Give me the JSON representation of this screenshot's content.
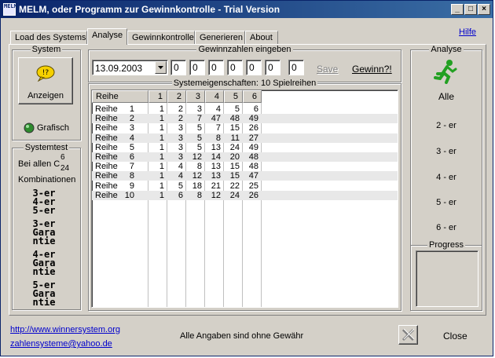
{
  "window": {
    "title": "MELM, oder Programm zur Gewinnkontrolle - Trial Version",
    "icon_text": "MELM",
    "controls": [
      "_",
      "□",
      "×"
    ]
  },
  "tabs": [
    {
      "label": "Load des Systems",
      "active": false
    },
    {
      "label": "Analyse",
      "active": true
    },
    {
      "label": "Gewinnkontrolle",
      "active": false
    },
    {
      "label": "Generieren",
      "active": false
    },
    {
      "label": "About",
      "active": false
    }
  ],
  "help_link": "Hilfe",
  "system": {
    "title": "System",
    "show_button": "Anzeigen",
    "grafisch_label": "Grafisch"
  },
  "systemtest": {
    "title": "Systemtest",
    "bei_allen": "Bei allen C",
    "sup": "6",
    "sub": "24",
    "kombinationen": "Kombinationen",
    "lines": [
      "3-er",
      "4-er",
      "5-er",
      "3-er",
      "Gara",
      "ntie",
      "4-er",
      "Gara",
      "ntie",
      "5-er",
      "Gara",
      "ntie"
    ]
  },
  "gewinnzahlen": {
    "title": "Gewinnzahlen eingeben",
    "date": "13.09.2003",
    "numbers": [
      "0",
      "0",
      "0",
      "0",
      "0",
      "0",
      "0"
    ],
    "save_label": "Save",
    "gewinn_label": "Gewinn?!"
  },
  "systemeigenschaften": {
    "title": "Systemeigenschaften: 10 Spielreihen",
    "columns": [
      "Reihe",
      "1",
      "2",
      "3",
      "4",
      "5",
      "6"
    ],
    "rows": [
      {
        "label": "Reihe",
        "num": "1",
        "values": [
          "1",
          "2",
          "3",
          "4",
          "5",
          "6"
        ]
      },
      {
        "label": "Reihe",
        "num": "2",
        "values": [
          "1",
          "2",
          "7",
          "47",
          "48",
          "49"
        ]
      },
      {
        "label": "Reihe",
        "num": "3",
        "values": [
          "1",
          "3",
          "5",
          "7",
          "15",
          "26"
        ]
      },
      {
        "label": "Reihe",
        "num": "4",
        "values": [
          "1",
          "3",
          "5",
          "8",
          "11",
          "27"
        ]
      },
      {
        "label": "Reihe",
        "num": "5",
        "values": [
          "1",
          "3",
          "5",
          "13",
          "24",
          "49"
        ]
      },
      {
        "label": "Reihe",
        "num": "6",
        "values": [
          "1",
          "3",
          "12",
          "14",
          "20",
          "48"
        ]
      },
      {
        "label": "Reihe",
        "num": "7",
        "values": [
          "1",
          "4",
          "8",
          "13",
          "15",
          "48"
        ]
      },
      {
        "label": "Reihe",
        "num": "8",
        "values": [
          "1",
          "4",
          "12",
          "13",
          "15",
          "47"
        ]
      },
      {
        "label": "Reihe",
        "num": "9",
        "values": [
          "1",
          "5",
          "18",
          "21",
          "22",
          "25"
        ]
      },
      {
        "label": "Reihe",
        "num": "10",
        "values": [
          "1",
          "6",
          "8",
          "12",
          "24",
          "26"
        ]
      }
    ]
  },
  "analyse": {
    "title": "Analyse",
    "alle_label": "Alle",
    "items": [
      "2 - er",
      "3 - er",
      "4 - er",
      "5 - er",
      "6 - er"
    ],
    "progress_title": "Progress"
  },
  "footer": {
    "url": "http://www.winnersystem.org",
    "email": "zahlensysteme@yahoo.de",
    "disclaimer": "Alle Angaben sind ohne Gewähr",
    "close_label": "Close"
  },
  "colors": {
    "title_bar_start": "#0a246a",
    "title_bar_end": "#3a6ea5",
    "link": "#0000cc",
    "runner_green": "#22a022",
    "grafisch_led": "#2e8b2e"
  }
}
